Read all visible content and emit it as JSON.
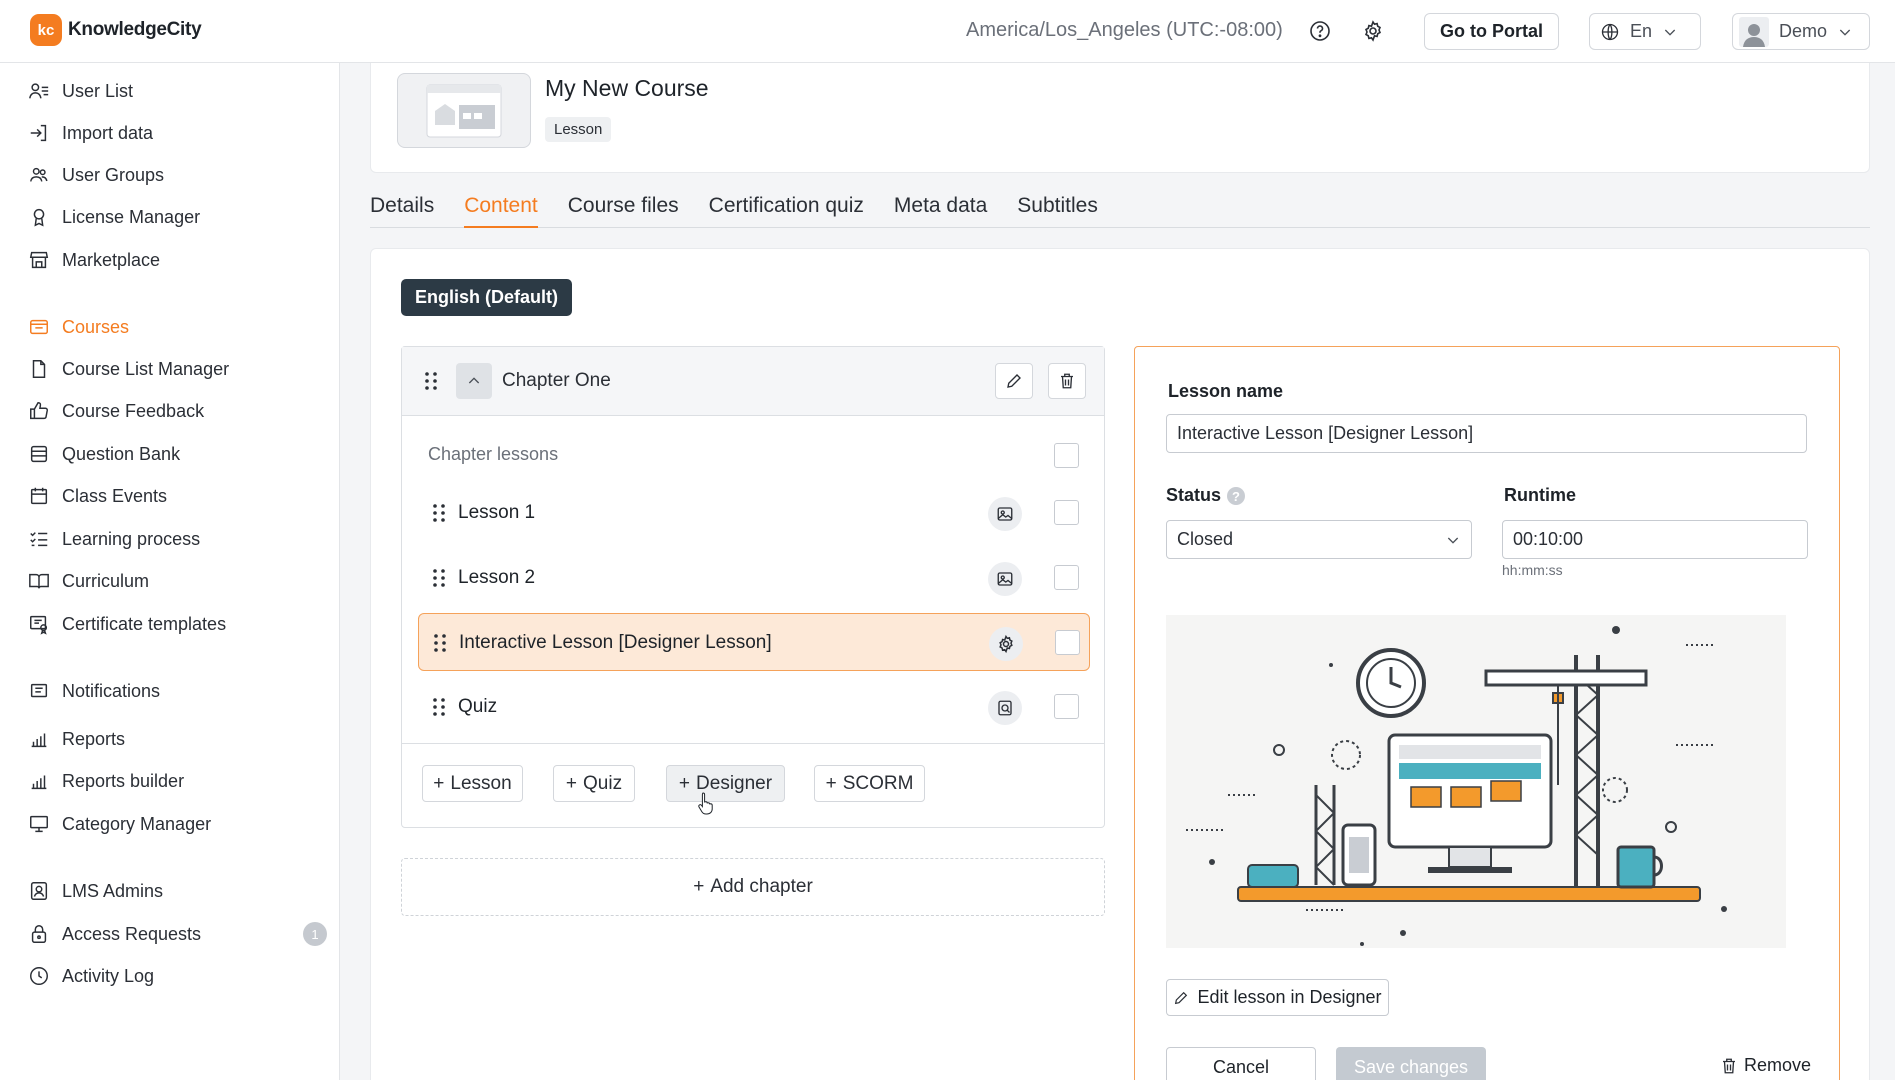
{
  "brand": {
    "name": "KnowledgeCity",
    "mark": "kc",
    "accent": "#f47c20"
  },
  "topbar": {
    "timezone": "America/Los_Angeles (UTC:-08:00)",
    "portal_label": "Go to Portal",
    "language": "En",
    "user": "Demo"
  },
  "sidebar": {
    "items": [
      {
        "label": "User List",
        "icon": "user-list-icon"
      },
      {
        "label": "Import data",
        "icon": "import-icon"
      },
      {
        "label": "User Groups",
        "icon": "user-groups-icon"
      },
      {
        "label": "License Manager",
        "icon": "license-icon"
      },
      {
        "label": "Marketplace",
        "icon": "store-icon"
      },
      {
        "label": "Courses",
        "icon": "courses-icon",
        "active": true
      },
      {
        "label": "Course List Manager",
        "icon": "file-icon"
      },
      {
        "label": "Course Feedback",
        "icon": "thumbs-up-icon"
      },
      {
        "label": "Question Bank",
        "icon": "database-icon"
      },
      {
        "label": "Class Events",
        "icon": "calendar-icon"
      },
      {
        "label": "Learning process",
        "icon": "checklist-icon"
      },
      {
        "label": "Curriculum",
        "icon": "book-icon"
      },
      {
        "label": "Certificate templates",
        "icon": "certificate-icon"
      },
      {
        "label": "Notifications",
        "icon": "notification-icon"
      },
      {
        "label": "Reports",
        "icon": "bar-chart-icon"
      },
      {
        "label": "Reports builder",
        "icon": "bar-chart-icon"
      },
      {
        "label": "Category Manager",
        "icon": "monitor-icon"
      },
      {
        "label": "LMS Admins",
        "icon": "admin-icon"
      },
      {
        "label": "Access Requests",
        "icon": "lock-icon",
        "badge": "1"
      },
      {
        "label": "Activity Log",
        "icon": "clock-icon"
      }
    ]
  },
  "course": {
    "title": "My New Course",
    "tag": "Lesson"
  },
  "tabs": [
    "Details",
    "Content",
    "Course files",
    "Certification quiz",
    "Meta data",
    "Subtitles"
  ],
  "content": {
    "language_pill": "English (Default)",
    "chapter": {
      "title": "Chapter One",
      "lessons_label": "Chapter lessons",
      "lessons": [
        {
          "name": "Lesson 1",
          "icon": "image-icon"
        },
        {
          "name": "Lesson 2",
          "icon": "image-icon"
        },
        {
          "name": "Interactive Lesson [Designer Lesson]",
          "icon": "gear-icon",
          "selected": true
        },
        {
          "name": "Quiz",
          "icon": "quiz-icon"
        }
      ],
      "add_buttons": [
        "Lesson",
        "Quiz",
        "Designer",
        "SCORM"
      ]
    },
    "add_chapter": "Add chapter"
  },
  "lesson_panel": {
    "name_label": "Lesson name",
    "name_value": "Interactive Lesson [Designer Lesson]",
    "status_label": "Status",
    "status_help": "?",
    "status_value": "Closed",
    "runtime_label": "Runtime",
    "runtime_value": "00:10:00",
    "runtime_hint": "hh:mm:ss",
    "edit_designer_label": "Edit lesson in Designer",
    "cancel_label": "Cancel",
    "save_label": "Save changes",
    "remove_label": "Remove"
  }
}
